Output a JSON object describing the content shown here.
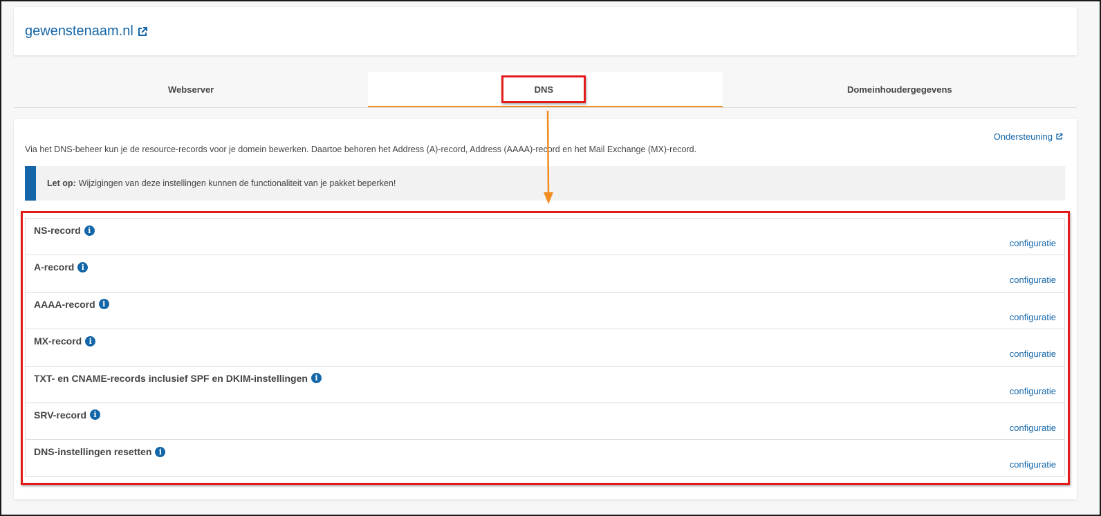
{
  "header": {
    "site_name": "gewenstenaam.nl",
    "external_icon": "external-link-icon"
  },
  "tabs": [
    {
      "label": "Webserver",
      "active": false
    },
    {
      "label": "DNS",
      "active": true
    },
    {
      "label": "Domeinhoudergegevens",
      "active": false
    }
  ],
  "content": {
    "support_link": "Ondersteuning",
    "intro": "Via het DNS-beheer kun je de resource-records voor je domein bewerken. Daartoe behoren het Address (A)-record, Address (AAAA)-record en het Mail Exchange (MX)-record.",
    "notice_label": "Let op:",
    "notice_text": "Wijzigingen van deze instellingen kunnen de functionaliteit van je pakket beperken!"
  },
  "records": [
    {
      "title": "NS-record",
      "link": "configuratie"
    },
    {
      "title": "A-record",
      "link": "configuratie"
    },
    {
      "title": "AAAA-record",
      "link": "configuratie"
    },
    {
      "title": "MX-record",
      "link": "configuratie"
    },
    {
      "title": "TXT- en CNAME-records inclusief SPF en DKIM-instellingen",
      "link": "configuratie"
    },
    {
      "title": "SRV-record",
      "link": "configuratie"
    },
    {
      "title": "DNS-instellingen resetten",
      "link": "configuratie"
    }
  ],
  "colors": {
    "accent": "#1466a8",
    "tab_underline": "#f28c1e",
    "highlight": "#e31b1b",
    "arrow": "#f28c1e"
  }
}
